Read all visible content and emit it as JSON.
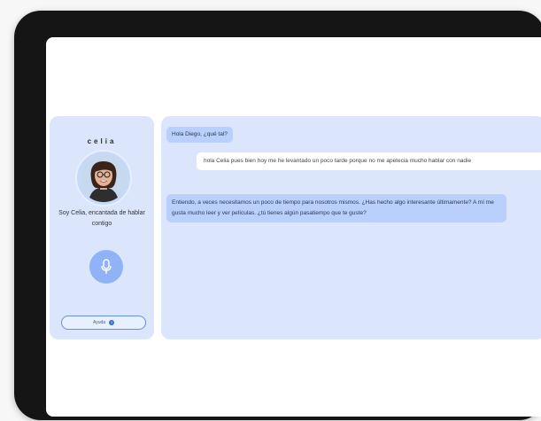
{
  "assistant": {
    "name": "celia",
    "greeting": "Soy Celia, encantada de hablar contigo",
    "help_label": "Ayuda",
    "help_icon": "info-icon",
    "mic_icon": "microphone-icon"
  },
  "chat": {
    "messages": [
      {
        "role": "assistant",
        "text": "Hola Diego, ¿qué tal?"
      },
      {
        "role": "user",
        "text": "hola Celia pues bien hoy me he levantado un poco tarde porque no me apetecia mucho hablar con nadie"
      },
      {
        "role": "assistant",
        "text": "Entiendo, a veces necesitamos un poco de tiempo para nosotros mismos. ¿Has hecho algo interesante últimamente? A mí me gusta mucho leer y ver películas. ¿tú tienes algún pasatiempo que te guste?"
      }
    ]
  },
  "colors": {
    "panel_bg": "#dbe6fc",
    "bot_bubble": "#b8d0fb",
    "user_bubble": "#ffffff",
    "mic_button": "#8fb3f6"
  }
}
